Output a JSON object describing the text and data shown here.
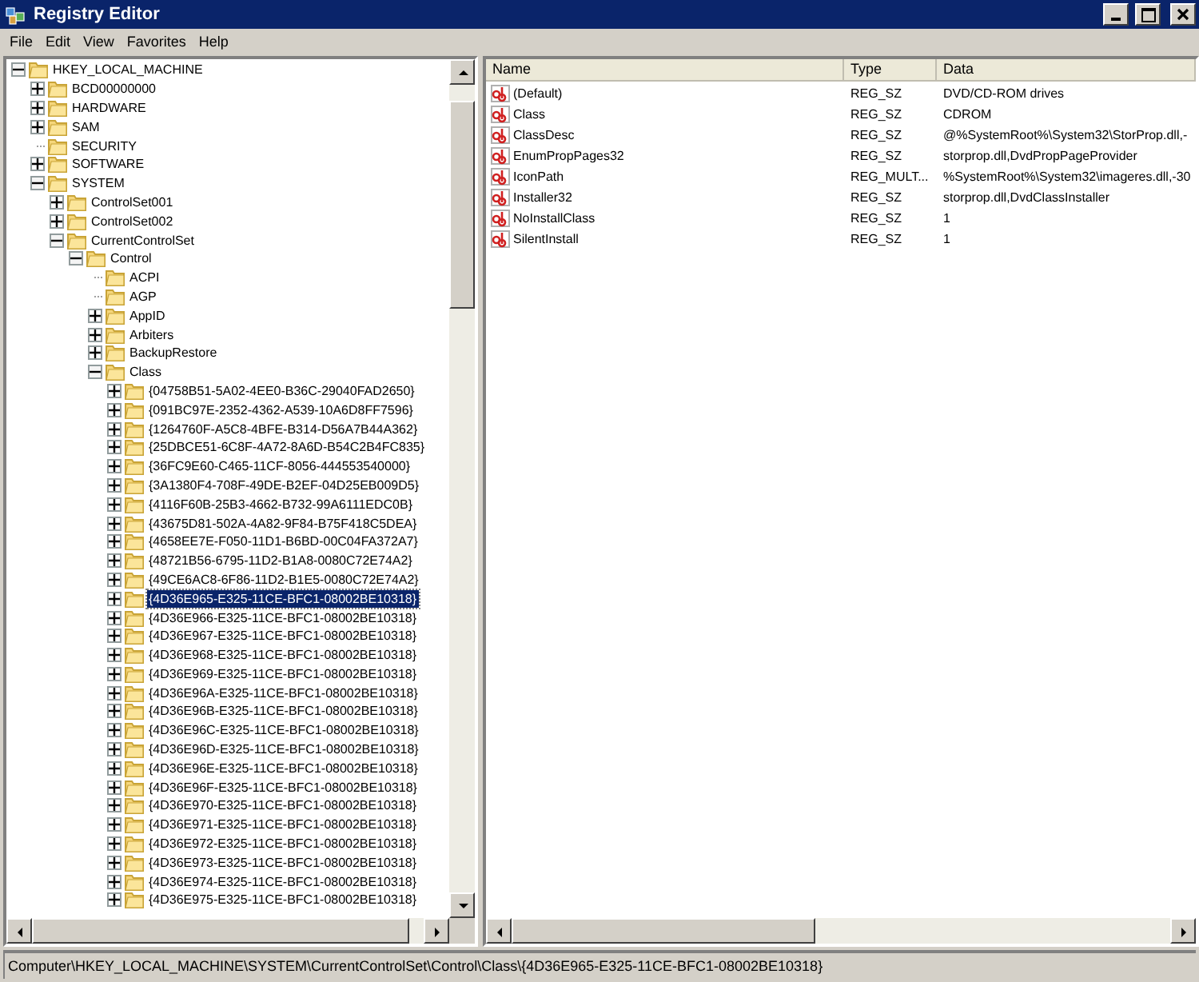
{
  "window": {
    "title": "Registry Editor"
  },
  "menu": [
    "File",
    "Edit",
    "View",
    "Favorites",
    "Help"
  ],
  "tree": [
    {
      "label": "HKEY_LOCAL_MACHINE",
      "kind": "branch",
      "expanded": true,
      "selected": false,
      "children": [
        {
          "label": "BCD00000000",
          "kind": "branch",
          "expanded": false,
          "selected": false
        },
        {
          "label": "HARDWARE",
          "kind": "branch",
          "expanded": false,
          "selected": false
        },
        {
          "label": "SAM",
          "kind": "branch",
          "expanded": false,
          "selected": false
        },
        {
          "label": "SECURITY",
          "kind": "leaf",
          "selected": false
        },
        {
          "label": "SOFTWARE",
          "kind": "branch",
          "expanded": false,
          "selected": false
        },
        {
          "label": "SYSTEM",
          "kind": "branch",
          "expanded": true,
          "selected": false,
          "children": [
            {
              "label": "ControlSet001",
              "kind": "branch",
              "expanded": false,
              "selected": false
            },
            {
              "label": "ControlSet002",
              "kind": "branch",
              "expanded": false,
              "selected": false
            },
            {
              "label": "CurrentControlSet",
              "kind": "branch",
              "expanded": true,
              "selected": false,
              "children": [
                {
                  "label": "Control",
                  "kind": "branch",
                  "expanded": true,
                  "selected": false,
                  "children": [
                    {
                      "label": "ACPI",
                      "kind": "leaf",
                      "selected": false
                    },
                    {
                      "label": "AGP",
                      "kind": "leaf",
                      "selected": false
                    },
                    {
                      "label": "AppID",
                      "kind": "branch",
                      "expanded": false,
                      "selected": false
                    },
                    {
                      "label": "Arbiters",
                      "kind": "branch",
                      "expanded": false,
                      "selected": false
                    },
                    {
                      "label": "BackupRestore",
                      "kind": "branch",
                      "expanded": false,
                      "selected": false
                    },
                    {
                      "label": "Class",
                      "kind": "branch",
                      "expanded": true,
                      "selected": false,
                      "children": [
                        {
                          "label": "{04758B51-5A02-4EE0-B36C-29040FAD2650}",
                          "kind": "branch",
                          "expanded": false,
                          "selected": false
                        },
                        {
                          "label": "{091BC97E-2352-4362-A539-10A6D8FF7596}",
                          "kind": "branch",
                          "expanded": false,
                          "selected": false
                        },
                        {
                          "label": "{1264760F-A5C8-4BFE-B314-D56A7B44A362}",
                          "kind": "branch",
                          "expanded": false,
                          "selected": false
                        },
                        {
                          "label": "{25DBCE51-6C8F-4A72-8A6D-B54C2B4FC835}",
                          "kind": "branch",
                          "expanded": false,
                          "selected": false
                        },
                        {
                          "label": "{36FC9E60-C465-11CF-8056-444553540000}",
                          "kind": "branch",
                          "expanded": false,
                          "selected": false
                        },
                        {
                          "label": "{3A1380F4-708F-49DE-B2EF-04D25EB009D5}",
                          "kind": "branch",
                          "expanded": false,
                          "selected": false
                        },
                        {
                          "label": "{4116F60B-25B3-4662-B732-99A6111EDC0B}",
                          "kind": "branch",
                          "expanded": false,
                          "selected": false
                        },
                        {
                          "label": "{43675D81-502A-4A82-9F84-B75F418C5DEA}",
                          "kind": "branch",
                          "expanded": false,
                          "selected": false
                        },
                        {
                          "label": "{4658EE7E-F050-11D1-B6BD-00C04FA372A7}",
                          "kind": "branch",
                          "expanded": false,
                          "selected": false
                        },
                        {
                          "label": "{48721B56-6795-11D2-B1A8-0080C72E74A2}",
                          "kind": "branch",
                          "expanded": false,
                          "selected": false
                        },
                        {
                          "label": "{49CE6AC8-6F86-11D2-B1E5-0080C72E74A2}",
                          "kind": "branch",
                          "expanded": false,
                          "selected": false
                        },
                        {
                          "label": "{4D36E965-E325-11CE-BFC1-08002BE10318}",
                          "kind": "branch",
                          "expanded": false,
                          "selected": true
                        },
                        {
                          "label": "{4D36E966-E325-11CE-BFC1-08002BE10318}",
                          "kind": "branch",
                          "expanded": false,
                          "selected": false
                        },
                        {
                          "label": "{4D36E967-E325-11CE-BFC1-08002BE10318}",
                          "kind": "branch",
                          "expanded": false,
                          "selected": false
                        },
                        {
                          "label": "{4D36E968-E325-11CE-BFC1-08002BE10318}",
                          "kind": "branch",
                          "expanded": false,
                          "selected": false
                        },
                        {
                          "label": "{4D36E969-E325-11CE-BFC1-08002BE10318}",
                          "kind": "branch",
                          "expanded": false,
                          "selected": false
                        },
                        {
                          "label": "{4D36E96A-E325-11CE-BFC1-08002BE10318}",
                          "kind": "branch",
                          "expanded": false,
                          "selected": false
                        },
                        {
                          "label": "{4D36E96B-E325-11CE-BFC1-08002BE10318}",
                          "kind": "branch",
                          "expanded": false,
                          "selected": false
                        },
                        {
                          "label": "{4D36E96C-E325-11CE-BFC1-08002BE10318}",
                          "kind": "branch",
                          "expanded": false,
                          "selected": false
                        },
                        {
                          "label": "{4D36E96D-E325-11CE-BFC1-08002BE10318}",
                          "kind": "branch",
                          "expanded": false,
                          "selected": false
                        },
                        {
                          "label": "{4D36E96E-E325-11CE-BFC1-08002BE10318}",
                          "kind": "branch",
                          "expanded": false,
                          "selected": false
                        },
                        {
                          "label": "{4D36E96F-E325-11CE-BFC1-08002BE10318}",
                          "kind": "branch",
                          "expanded": false,
                          "selected": false
                        },
                        {
                          "label": "{4D36E970-E325-11CE-BFC1-08002BE10318}",
                          "kind": "branch",
                          "expanded": false,
                          "selected": false
                        },
                        {
                          "label": "{4D36E971-E325-11CE-BFC1-08002BE10318}",
                          "kind": "branch",
                          "expanded": false,
                          "selected": false
                        },
                        {
                          "label": "{4D36E972-E325-11CE-BFC1-08002BE10318}",
                          "kind": "branch",
                          "expanded": false,
                          "selected": false
                        },
                        {
                          "label": "{4D36E973-E325-11CE-BFC1-08002BE10318}",
                          "kind": "branch",
                          "expanded": false,
                          "selected": false
                        },
                        {
                          "label": "{4D36E974-E325-11CE-BFC1-08002BE10318}",
                          "kind": "branch",
                          "expanded": false,
                          "selected": false
                        },
                        {
                          "label": "{4D36E975-E325-11CE-BFC1-08002BE10318}",
                          "kind": "branch",
                          "expanded": false,
                          "selected": false
                        }
                      ]
                    }
                  ]
                }
              ]
            }
          ]
        }
      ]
    }
  ],
  "values": {
    "columns": [
      "Name",
      "Type",
      "Data"
    ],
    "rows": [
      {
        "name": "(Default)",
        "type": "REG_SZ",
        "data": "DVD/CD-ROM drives"
      },
      {
        "name": "Class",
        "type": "REG_SZ",
        "data": "CDROM"
      },
      {
        "name": "ClassDesc",
        "type": "REG_SZ",
        "data": "@%SystemRoot%\\System32\\StorProp.dll,-"
      },
      {
        "name": "EnumPropPages32",
        "type": "REG_SZ",
        "data": "storprop.dll,DvdPropPageProvider"
      },
      {
        "name": "IconPath",
        "type": "REG_MULT...",
        "data": "%SystemRoot%\\System32\\imageres.dll,-30"
      },
      {
        "name": "Installer32",
        "type": "REG_SZ",
        "data": "storprop.dll,DvdClassInstaller"
      },
      {
        "name": "NoInstallClass",
        "type": "REG_SZ",
        "data": "1"
      },
      {
        "name": "SilentInstall",
        "type": "REG_SZ",
        "data": "1"
      }
    ]
  },
  "status_bar": "Computer\\HKEY_LOCAL_MACHINE\\SYSTEM\\CurrentControlSet\\Control\\Class\\{4D36E965-E325-11CE-BFC1-08002BE10318}"
}
